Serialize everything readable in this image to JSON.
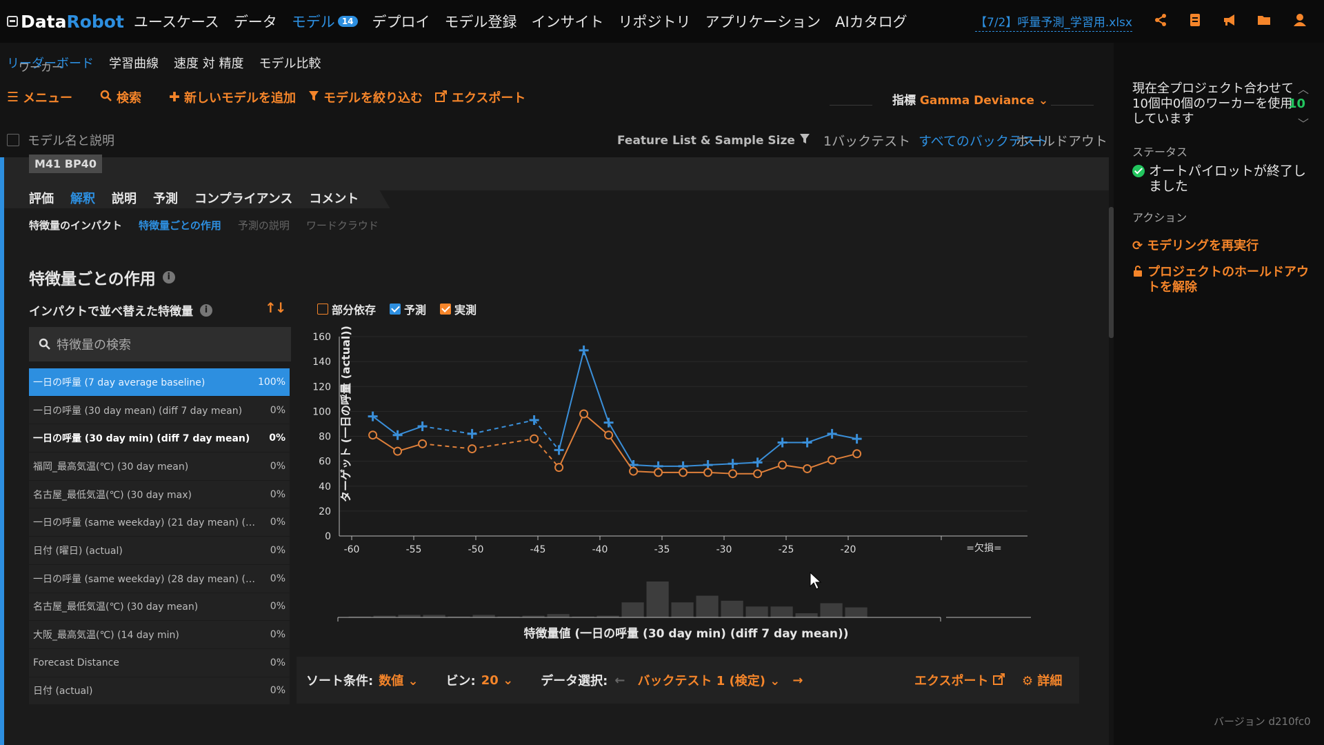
{
  "app": {
    "logo_data": "Data",
    "logo_robot": "Robot"
  },
  "nav": {
    "items": [
      "ユースケース",
      "データ",
      "モデル",
      "デプロイ",
      "モデル登録",
      "インサイト",
      "リポジトリ",
      "アプリケーション",
      "AIカタログ"
    ],
    "model_badge": "14",
    "filename": "【7/2】呼量予測_学習用.xlsx"
  },
  "subnav": {
    "items": [
      "リーダーボード",
      "学習曲線",
      "速度 対 精度",
      "モデル比較"
    ]
  },
  "toolbar": {
    "menu": "メニュー",
    "search": "検索",
    "add_model": "新しいモデルを追加",
    "filter": "モデルを絞り込む",
    "export": "エクスポート",
    "metric_label": "指標",
    "metric_value": "Gamma Deviance"
  },
  "filter_row": {
    "model_name": "モデル名と説明",
    "feature_list": "Feature List & Sample Size",
    "backtest1": "1バックテスト",
    "all_backtests": "すべてのバックテスト",
    "holdout": "ホールドアウト"
  },
  "model": {
    "tag": "M41  BP40",
    "tabs": [
      "評価",
      "解釈",
      "説明",
      "予測",
      "コンプライアンス",
      "コメント"
    ],
    "inner_tabs": [
      "特徴量のインパクト",
      "特徴量ごとの作用",
      "予測の説明",
      "ワードクラウド"
    ]
  },
  "panel": {
    "title": "特徴量ごとの作用",
    "sort_title": "インパクトで並べ替えた特徴量",
    "search_placeholder": "特徴量の検索"
  },
  "features": [
    {
      "name": "一日の呼量 (7 day average baseline)",
      "pct": "100%"
    },
    {
      "name": "一日の呼量 (30 day mean) (diff 7 day mean)",
      "pct": "0%"
    },
    {
      "name": "一日の呼量 (30 day min) (diff 7 day mean)",
      "pct": "0%"
    },
    {
      "name": "福岡_最高気温(℃) (30 day mean)",
      "pct": "0%"
    },
    {
      "name": "名古屋_最低気温(℃) (30 day max)",
      "pct": "0%"
    },
    {
      "name": "一日の呼量 (same weekday) (21 day mean) (diff...",
      "pct": "0%"
    },
    {
      "name": "日付 (曜日) (actual)",
      "pct": "0%"
    },
    {
      "name": "一日の呼量 (same weekday) (28 day mean) (diff...",
      "pct": "0%"
    },
    {
      "name": "名古屋_最低気温(℃) (30 day mean)",
      "pct": "0%"
    },
    {
      "name": "大阪_最高気温(℃) (14 day min)",
      "pct": "0%"
    },
    {
      "name": "Forecast Distance",
      "pct": "0%"
    },
    {
      "name": "日付 (actual)",
      "pct": "0%"
    }
  ],
  "legend": {
    "partial": "部分依存",
    "predicted": "予測",
    "actual": "実測"
  },
  "chart_data": {
    "type": "line",
    "ylabel": "ターゲット (一日の呼量 (actual))",
    "xlabel": "特徴量値 (一日の呼量 (30 day min) (diff 7 day mean))",
    "xlim": [
      -61,
      -12
    ],
    "ylim": [
      0,
      160
    ],
    "x_ticks": [
      -60,
      -55,
      -50,
      -45,
      -40,
      -35,
      -30,
      -25,
      -20
    ],
    "y_ticks": [
      0,
      20,
      40,
      60,
      80,
      100,
      120,
      140,
      160
    ],
    "missing_label": "=欠損=",
    "series": [
      {
        "name": "予測",
        "color": "#3a8fd9",
        "x": [
          -58.3,
          -56.3,
          -54.3,
          -50.3,
          -45.3,
          -43.3,
          -41.3,
          -39.3,
          -37.3,
          -35.3,
          -33.3,
          -31.3,
          -29.3,
          -27.3,
          -25.3,
          -23.3,
          -21.3,
          -19.3
        ],
        "y": [
          96,
          81,
          88,
          82,
          93,
          69,
          149,
          91,
          57,
          56,
          56,
          57,
          58,
          59,
          75,
          75,
          82,
          78
        ]
      },
      {
        "name": "実測",
        "color": "#e0803a",
        "x": [
          -58.3,
          -56.3,
          -54.3,
          -50.3,
          -45.3,
          -43.3,
          -41.3,
          -39.3,
          -37.3,
          -35.3,
          -33.3,
          -31.3,
          -29.3,
          -27.3,
          -25.3,
          -23.3,
          -21.3,
          -19.3
        ],
        "y": [
          81,
          68,
          74,
          70,
          78,
          55,
          98,
          81,
          52,
          51,
          51,
          51,
          50,
          50,
          57,
          54,
          61,
          66
        ]
      }
    ],
    "histogram": {
      "x": [
        -59.3,
        -57.3,
        -55.3,
        -53.3,
        -51.3,
        -49.3,
        -47.3,
        -45.3,
        -43.3,
        -41.3,
        -39.3,
        -37.3,
        -35.3,
        -33.3,
        -31.3,
        -29.3,
        -27.3,
        -25.3,
        -23.3,
        -21.3,
        -19.3
      ],
      "counts": [
        1,
        2,
        3,
        3,
        1,
        3,
        1,
        2,
        4,
        1,
        2,
        18,
        43,
        18,
        26,
        20,
        13,
        13,
        5,
        17,
        12
      ]
    }
  },
  "bottom": {
    "sort_label": "ソート条件:",
    "sort_value": "数値",
    "bin_label": "ビン:",
    "bin_value": "20",
    "data_label": "データ選択:",
    "data_value": "バックテスト 1 (検定)",
    "export": "エクスポート",
    "detail": "詳細"
  },
  "sidebar": {
    "worker_head": "ワーカー",
    "worker_text": "現在全プロジェクト合わせて10個中0個のワーカーを使用しています",
    "worker_count": "10",
    "status_head": "ステータス",
    "status_text": "オートパイロットが終了しました",
    "action_head": "アクション",
    "action_rerun": "モデリングを再実行",
    "action_unlock": "プロジェクトのホールドアウトを解除",
    "version": "バージョン d210fc0"
  },
  "colors": {
    "accent_blue": "#2d8fe0",
    "accent_orange": "#f5852a",
    "success_green": "#22c55e"
  }
}
